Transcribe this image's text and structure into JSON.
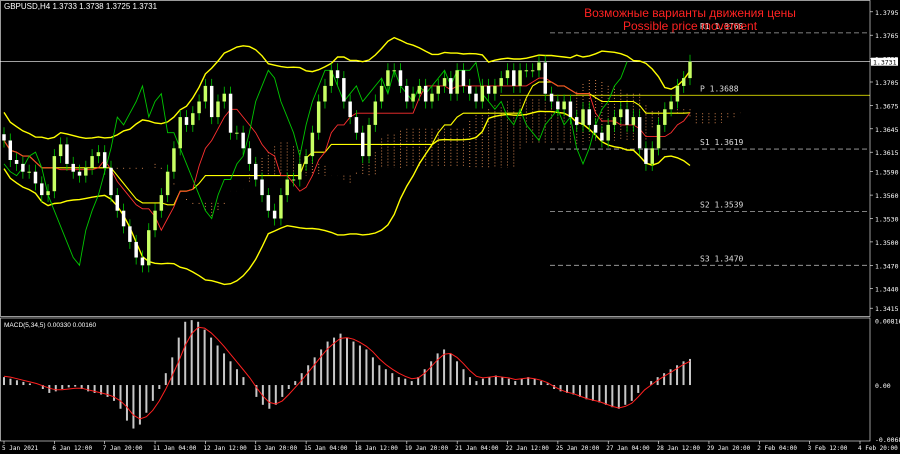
{
  "header": {
    "symbol": "GBPUSD,H4",
    "ohlc": "1.3733 1.3738 1.3725 1.3731"
  },
  "annotation": {
    "line1": "Возможные варианты движения цены",
    "line2": "Possible price movement"
  },
  "colors": {
    "background": "#000000",
    "bull": "#c8ff64",
    "bear": "#ffffff",
    "bollinger": "#ffff00",
    "ichimoku_fast": "#00c800",
    "ichimoku_slow": "#ff3030",
    "kijun": "#ffff00",
    "cloud": "#ffa060",
    "levels": "#aaaaaa",
    "annotation": "#ff2222",
    "macd_hist": "#c8c8c8",
    "macd_signal": "#ff2020"
  },
  "chart_data": [
    {
      "type": "candlestick",
      "title": "GBPUSD,H4",
      "ylim": [
        1.3405,
        1.3805
      ],
      "y_ticks": [
        "1.3795",
        "1.3765",
        "1.3735",
        "1.3705",
        "1.3675",
        "1.3645",
        "1.3615",
        "1.3590",
        "1.3560",
        "1.3530",
        "1.3500",
        "1.3470",
        "1.3440",
        "1.3415"
      ],
      "current_price": "1.3731",
      "x_ticks": [
        "5 Jan 2021",
        "6 Jan 12:00",
        "7 Jan 20:00",
        "11 Jan 04:00",
        "12 Jan 12:00",
        "13 Jan 20:00",
        "15 Jan 04:00",
        "18 Jan 12:00",
        "19 Jan 20:00",
        "21 Jan 04:00",
        "22 Jan 12:00",
        "25 Jan 20:00",
        "27 Jan 04:00",
        "28 Jan 12:00",
        "29 Jan 20:00",
        "2 Feb 04:00",
        "3 Feb 12:00",
        "4 Feb 20:00"
      ],
      "levels": [
        {
          "label": "R1",
          "value": "1.3768"
        },
        {
          "label": "P",
          "value": "1.3688"
        },
        {
          "label": "S1",
          "value": "1.3619"
        },
        {
          "label": "S2",
          "value": "1.3539"
        },
        {
          "label": "S3",
          "value": "1.3470"
        }
      ],
      "closes": [
        1.363,
        1.3605,
        1.36,
        1.359,
        1.359,
        1.3575,
        1.356,
        1.3565,
        1.361,
        1.3625,
        1.36,
        1.359,
        1.3585,
        1.3595,
        1.361,
        1.3615,
        1.3595,
        1.356,
        1.354,
        1.352,
        1.35,
        1.348,
        1.347,
        1.3515,
        1.354,
        1.356,
        1.359,
        1.362,
        1.366,
        1.365,
        1.3665,
        1.368,
        1.37,
        1.366,
        1.368,
        1.369,
        1.364,
        1.364,
        1.362,
        1.36,
        1.358,
        1.356,
        1.354,
        1.353,
        1.356,
        1.358,
        1.358,
        1.36,
        1.361,
        1.364,
        1.368,
        1.37,
        1.372,
        1.371,
        1.368,
        1.366,
        1.364,
        1.361,
        1.365,
        1.368,
        1.37,
        1.372,
        1.372,
        1.37,
        1.368,
        1.369,
        1.37,
        1.368,
        1.369,
        1.37,
        1.371,
        1.369,
        1.372,
        1.37,
        1.369,
        1.368,
        1.37,
        1.369,
        1.37,
        1.371,
        1.372,
        1.37,
        1.372,
        1.372,
        1.372,
        1.373,
        1.369,
        1.368,
        1.367,
        1.368,
        1.366,
        1.365,
        1.367,
        1.365,
        1.364,
        1.363,
        1.365,
        1.366,
        1.367,
        1.365,
        1.366,
        1.362,
        1.36,
        1.362,
        1.365,
        1.367,
        1.368,
        1.37,
        1.371,
        1.3731
      ],
      "macd": {
        "label": "MACD(5,34,5) 0.00330 0.00160",
        "ylim": [
          -0.00695,
          0.00835
        ],
        "y_ticks": [
          "0.00816",
          "0.00",
          "-0.00683"
        ],
        "hist": [
          0.001,
          0.0008,
          0.0006,
          0.0004,
          0.0002,
          0.0,
          -0.0005,
          -0.001,
          -0.0008,
          -0.0005,
          -0.0003,
          -0.0002,
          -0.0005,
          -0.0008,
          -0.001,
          -0.0012,
          -0.0015,
          -0.002,
          -0.003,
          -0.0045,
          -0.0055,
          -0.005,
          -0.0035,
          -0.002,
          -0.0005,
          0.0015,
          0.0035,
          0.006,
          0.008,
          0.0082,
          0.008,
          0.007,
          0.006,
          0.005,
          0.004,
          0.003,
          0.002,
          0.001,
          0.0,
          -0.0015,
          -0.0025,
          -0.003,
          -0.0025,
          -0.0015,
          -0.0005,
          0.0005,
          0.0015,
          0.0025,
          0.0035,
          0.0045,
          0.0055,
          0.006,
          0.0065,
          0.006,
          0.0055,
          0.005,
          0.0045,
          0.0035,
          0.0025,
          0.002,
          0.0015,
          0.001,
          0.0008,
          0.0005,
          0.001,
          0.002,
          0.003,
          0.004,
          0.0045,
          0.004,
          0.003,
          0.002,
          0.001,
          0.0005,
          0.0008,
          0.001,
          0.0012,
          0.001,
          0.0008,
          0.0005,
          0.0008,
          0.001,
          0.0008,
          0.0005,
          0.0002,
          -0.0005,
          -0.0008,
          -0.001,
          -0.0012,
          -0.0015,
          -0.0018,
          -0.002,
          -0.0022,
          -0.0025,
          -0.0028,
          -0.003,
          -0.0025,
          -0.002,
          -0.001,
          0.0,
          0.0005,
          0.001,
          0.0015,
          0.002,
          0.0025,
          0.003,
          0.0033
        ],
        "signal": [
          0.0011,
          0.001,
          0.0008,
          0.0006,
          0.0004,
          0.0002,
          -0.0001,
          -0.0004,
          -0.0006,
          -0.0006,
          -0.0005,
          -0.0004,
          -0.0004,
          -0.0006,
          -0.0008,
          -0.001,
          -0.0012,
          -0.0015,
          -0.002,
          -0.0028,
          -0.0038,
          -0.0043,
          -0.004,
          -0.0032,
          -0.002,
          -0.0005,
          0.0012,
          0.003,
          0.005,
          0.0065,
          0.0073,
          0.0072,
          0.0066,
          0.0058,
          0.0049,
          0.0039,
          0.0029,
          0.0019,
          0.0009,
          -0.0003,
          -0.0014,
          -0.0022,
          -0.0024,
          -0.002,
          -0.0012,
          -0.0003,
          0.0006,
          0.0016,
          0.0026,
          0.0036,
          0.0046,
          0.0053,
          0.0059,
          0.006,
          0.0058,
          0.0054,
          0.0049,
          0.0042,
          0.0033,
          0.0026,
          0.002,
          0.0015,
          0.0011,
          0.0008,
          0.0009,
          0.0015,
          0.0023,
          0.0032,
          0.0039,
          0.004,
          0.0035,
          0.0027,
          0.0018,
          0.0011,
          0.0009,
          0.001,
          0.0011,
          0.001,
          0.0009,
          0.0007,
          0.0008,
          0.0009,
          0.0008,
          0.0006,
          0.0003,
          -0.0002,
          -0.0006,
          -0.0009,
          -0.0011,
          -0.0014,
          -0.0017,
          -0.0019,
          -0.0021,
          -0.0024,
          -0.0027,
          -0.0029,
          -0.0027,
          -0.0023,
          -0.0015,
          -0.0006,
          0.0,
          0.0006,
          0.0011,
          0.0016,
          0.0021,
          0.0026,
          0.003
        ]
      }
    }
  ]
}
